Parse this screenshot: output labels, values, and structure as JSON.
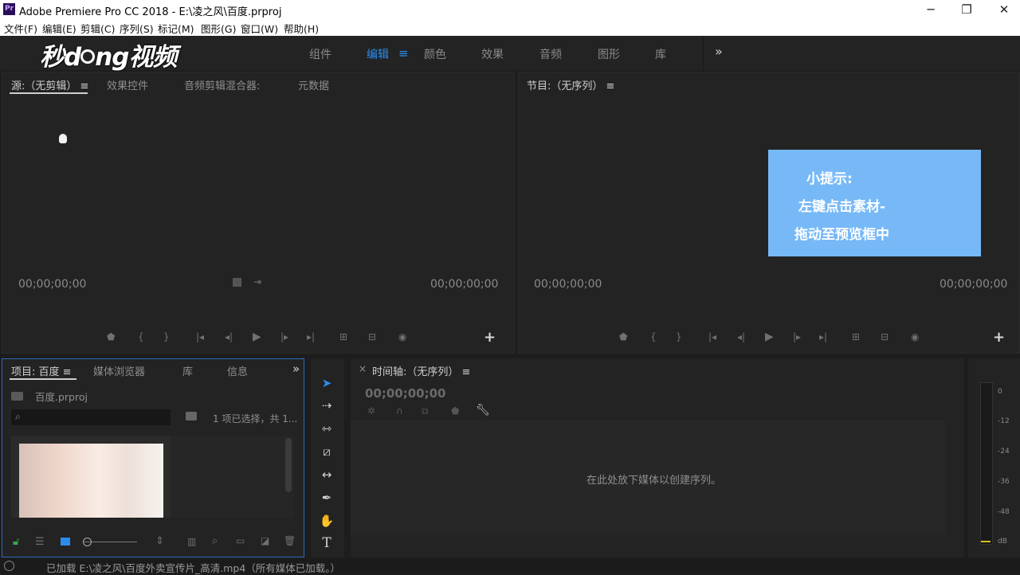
{
  "window": {
    "app_icon": "Pr",
    "title": "Adobe Premiere Pro CC 2018 - E:\\凌之风\\百度.prproj",
    "minimize": "─",
    "maximize": "❐",
    "close": "✕"
  },
  "menu": [
    "文件(F)",
    "编辑(E)",
    "剪辑(C)",
    "序列(S)",
    "标记(M)",
    "图形(G)",
    "窗口(W)",
    "帮助(H)"
  ],
  "logo_text": "秒d ng视频",
  "workspaces": {
    "tabs": [
      "组件",
      "编辑",
      "颜色",
      "效果",
      "音频",
      "图形",
      "库"
    ],
    "active": "编辑",
    "overflow": "»"
  },
  "source_panel": {
    "tabs": [
      "源:（无剪辑）",
      "效果控件",
      "音频剪辑混合器:",
      "元数据"
    ],
    "menu_icon": "≡",
    "timecode_left": "00;00;00;00",
    "timecode_right": "00;00;00;00",
    "add": "+"
  },
  "program_panel": {
    "tab": "节目:（无序列）",
    "menu_icon": "≡",
    "timecode_left": "00;00;00;00",
    "timecode_right": "00;00;00;00",
    "add": "+"
  },
  "tip": {
    "line1": "小提示:",
    "line2": "左键点击素材-",
    "line3": "拖动至预览框中"
  },
  "project_panel": {
    "tabs": [
      "项目: 百度",
      "媒体浏览器",
      "库",
      "信息"
    ],
    "menu_icon": "≡",
    "overflow": "»",
    "file": "百度.prproj",
    "search_placeholder": "",
    "selection_info": "1 项已选择，共 1..."
  },
  "timeline_panel": {
    "close": "×",
    "tab": "时间轴:（无序列）",
    "menu_icon": "≡",
    "timecode": "00;00;00;00",
    "drop_hint": "在此处放下媒体以创建序列。"
  },
  "audio_meter": {
    "labels": [
      "0",
      "-12",
      "-24",
      "-36",
      "-48",
      "dB"
    ]
  },
  "status": {
    "text": "已加载 E:\\凌之风\\百度外卖宣传片_高清.mp4（所有媒体已加载。）"
  }
}
